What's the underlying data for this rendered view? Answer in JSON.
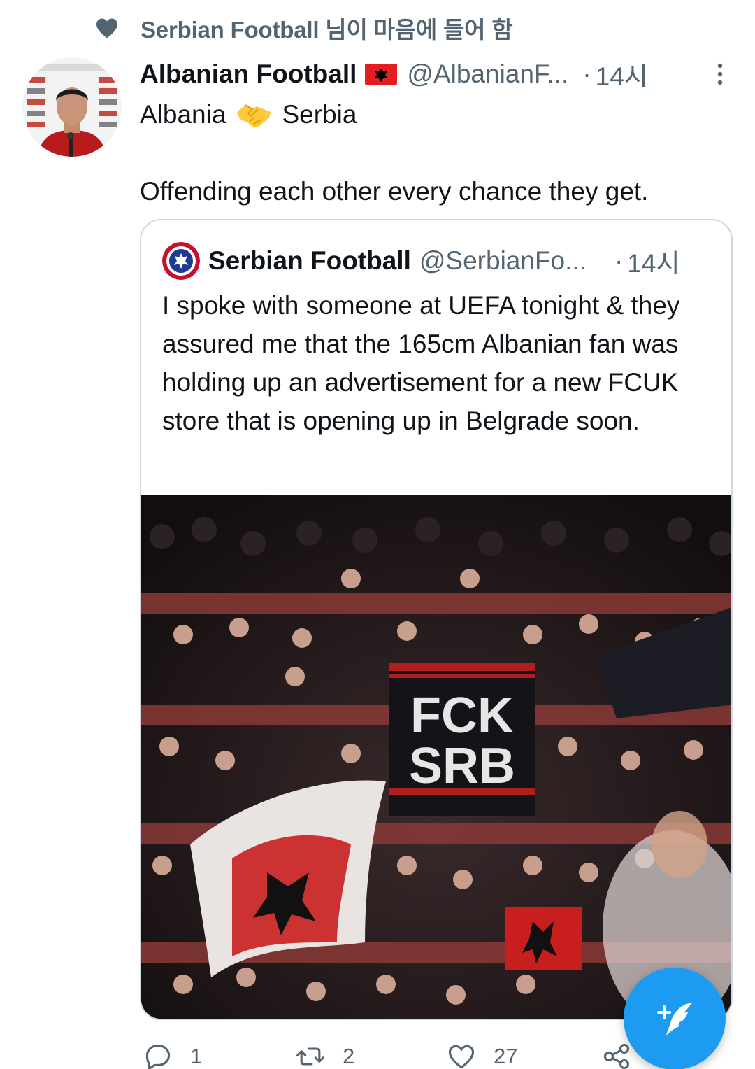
{
  "social_context": {
    "icon": "heart-icon",
    "text": "Serbian Football 님이 마음에 들어 함"
  },
  "tweet": {
    "display_name": "Albanian Football",
    "flag_icon": "albania-flag-icon",
    "handle": "@AlbanianF...",
    "separator": "·",
    "time": "14시",
    "text_line1_a": "Albania",
    "text_line1_emoji": "handshake-icon",
    "text_line1_b": "Serbia",
    "text_line2": "Offending each other every chance they get."
  },
  "quote": {
    "display_name": "Serbian Football",
    "handle": "@SerbianFo...",
    "separator": "·",
    "time": "14시",
    "text": "I spoke with someone at UEFA tonight & they assured me that the 165cm Albanian fan was holding up an advertisement for a new FCUK store that is opening up in Belgrade soon.",
    "image_banner_line1": "FCK",
    "image_banner_line2": "SRB"
  },
  "actions": {
    "reply_count": "1",
    "retweet_count": "2",
    "like_count": "27"
  },
  "fab": {
    "icon": "compose-tweet-icon"
  },
  "colors": {
    "accent": "#1d9bf0",
    "secondary_text": "#536471",
    "border": "#cfd9de",
    "albania_red": "#e41e20"
  }
}
